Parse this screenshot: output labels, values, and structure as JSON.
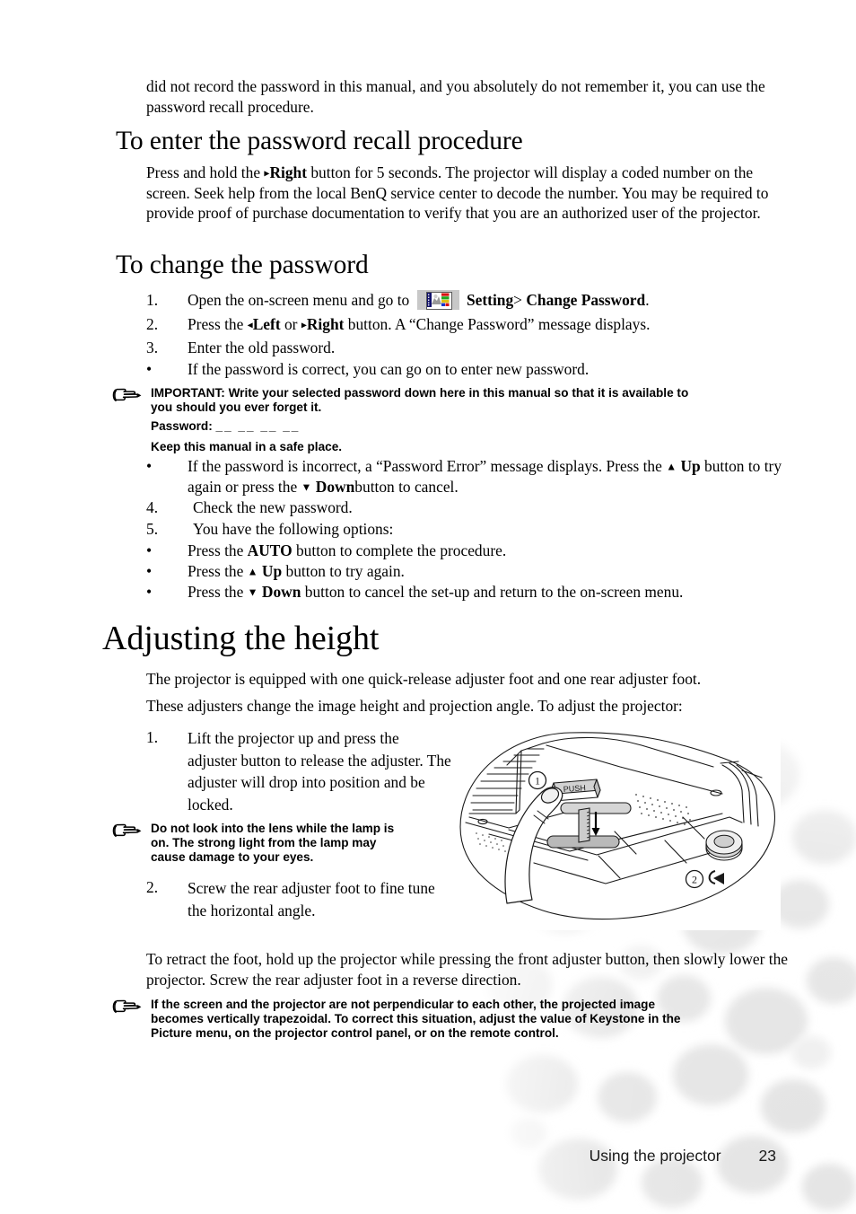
{
  "page": {
    "number": "23",
    "footer_label": "Using the projector"
  },
  "intro": {
    "text": "did not record the password in this manual, and you absolutely do not remember it, you can use the password recall procedure."
  },
  "recall_section": {
    "heading": "To enter the password recall procedure",
    "paragraph": "Press and hold the ▸ Right button for 5 seconds. The projector will display a coded number on the screen. Seek help from the local BenQ service center to decode the number. You may be required to provide proof of purchase documentation to verify that you are an authorized user of the projector.",
    "para_lead": "Press and hold the",
    "para_key": "Right",
    "para_rest": "button for 5 seconds. The projector will display a coded number on the screen. Seek help from the local BenQ service center to decode the number. You may be required to provide proof of purchase documentation to verify that you are an authorized user of the projector."
  },
  "change_section": {
    "heading": "To change the password",
    "steps": [
      {
        "marker": "1.",
        "pre": "Open the on-screen menu and go to",
        "icon": "setting-menu-icon",
        "menu": "Setting",
        "separator": ">",
        "submenu": "Change Password",
        "post": "."
      },
      {
        "marker": "2.",
        "pre": "Press the",
        "key1": "Left",
        "mid": "or",
        "key2": "Right",
        "post": "button. A “Change Password” message displays."
      },
      {
        "marker": "3.",
        "text": "Enter the old password."
      },
      {
        "marker": "•",
        "text": "If the password is correct, you can go on to enter new password."
      }
    ],
    "note_important": {
      "icon": "pointing-hand-icon",
      "lines": [
        "IMPORTANT: Write your selected password down here in this manual so that it is available to",
        "you should you ever forget it."
      ],
      "password_label": "Password:",
      "password_blanks": "__ __ __ __",
      "keep_line": "Keep this manual in a safe place."
    },
    "incorrect_bullet": {
      "marker": "•",
      "pre": "If the password is incorrect, a “Password Error” message displays. Press the",
      "key1": "Up",
      "mid": "button to try again or press the",
      "key2": "Down",
      "post": "button to cancel."
    },
    "steps_tail": [
      {
        "marker": "4.",
        "text": "Check the new password."
      },
      {
        "marker": "5.",
        "text": "You have the following options:"
      }
    ],
    "options": [
      {
        "marker": "•",
        "pre": "Press the",
        "key": "AUTO",
        "post": "button to complete the procedure.",
        "arrow": ""
      },
      {
        "marker": "•",
        "pre": "Press the",
        "key": "Up",
        "post": "button to try again.",
        "arrow": "up"
      },
      {
        "marker": "•",
        "pre": "Press the",
        "key": "Down",
        "post": "button to cancel the set-up and return to the on-screen menu.",
        "arrow": "down"
      }
    ]
  },
  "height_section": {
    "heading": "Adjusting the height",
    "paragraph1": "The projector is equipped with one quick-release adjuster foot and one rear adjuster foot.",
    "paragraph2": "These adjusters change the image height and projection angle. To adjust the projector:",
    "step1": {
      "marker": "1.",
      "text": "Lift the projector up and press the adjuster button to release the adjuster. The adjuster will drop into position and be locked."
    },
    "note_lens": {
      "icon": "pointing-hand-icon",
      "lines": [
        "Do not look into the lens while the lamp is",
        "on. The strong light from the lamp may",
        "cause damage to your eyes."
      ]
    },
    "step2": {
      "marker": "2.",
      "text": "Screw the rear adjuster foot to fine tune the horizontal angle."
    },
    "retract_paragraph": "To retract the foot, hold up the projector while pressing the front adjuster button, then slowly lower the projector. Screw the rear adjuster foot in a reverse direction.",
    "note_keystone": {
      "icon": "pointing-hand-icon",
      "lines": [
        "If the screen and the projector are not perpendicular to each other, the projected image",
        "becomes vertically trapezoidal. To correct this situation, adjust the value of Keystone in the",
        "Picture menu, on the projector control panel, or on the remote control."
      ]
    },
    "figure": {
      "name": "projector-underside-illustration",
      "callout_1": "1",
      "callout_2": "2",
      "push_label": "PUSH"
    }
  }
}
